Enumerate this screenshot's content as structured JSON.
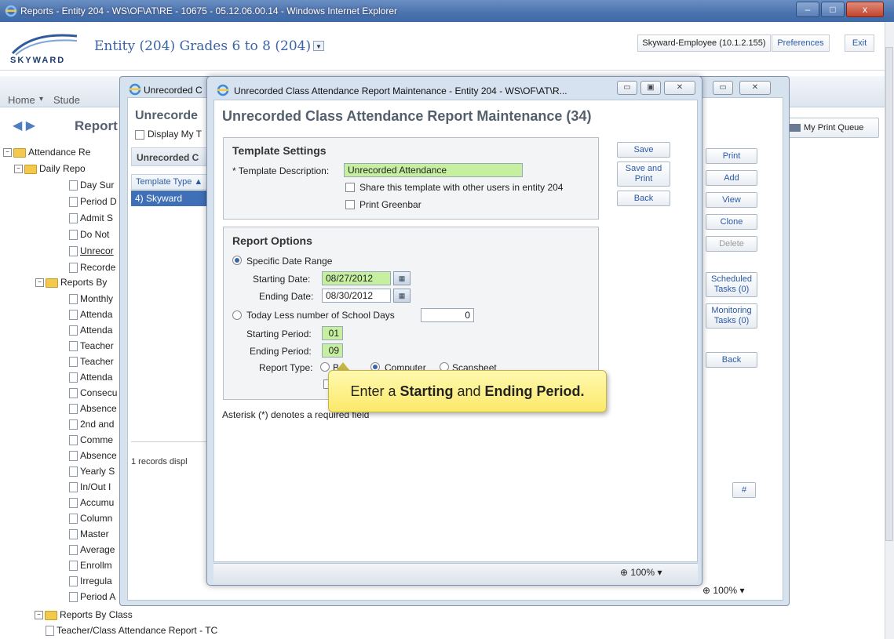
{
  "window": {
    "title": "Reports - Entity 204 - WS\\OF\\AT\\RE - 10675 - 05.12.06.00.14 - Windows Internet Explorer",
    "min": "–",
    "max": "□",
    "close": "x"
  },
  "header": {
    "logo": "SKYWARD",
    "entity_title": "Entity (204) Grades 6 to 8 (204)",
    "entity_dropdown": "▼",
    "user": "Skyward-Employee (10.1.2.155)",
    "preferences": "Preferences",
    "exit": "Exit"
  },
  "nav": {
    "home": "Home",
    "home_arrow": "▾",
    "student": "Stude"
  },
  "report_area": {
    "arrows": "◀ ▶",
    "title": "Report",
    "print_queue": "My Print Queue"
  },
  "tree": {
    "root": "Attendance Re",
    "daily": "Daily Repo",
    "daily_items": [
      "Day Sur",
      "Period D",
      "Admit S",
      "Do Not",
      "Unrecor",
      "Recorde"
    ],
    "reports_by": "Reports By",
    "reports_by_items": [
      "Monthly",
      "Attenda",
      "Attenda",
      "Teacher",
      "Teacher",
      "Attenda",
      "Consecu",
      "Absence",
      "2nd and",
      "Comme",
      "Absence",
      "Yearly S",
      "In/Out I",
      "Accumu",
      "Column",
      "Master",
      "Average",
      "Enrollm",
      "Irregula",
      "Period A"
    ],
    "by_class": "Reports By Class",
    "by_class_items": [
      "Teacher/Class Attendance Report - TC"
    ]
  },
  "back_window": {
    "title": "Unrecorded C",
    "heading": "Unrecorde",
    "display_my": "Display My T",
    "grid_heading": "Unrecorded C",
    "column": "Template Type ▲",
    "row": "4) Skyward",
    "records": "1 records displ",
    "zoom": "100%",
    "buttons": {
      "print": "Print",
      "add": "Add",
      "view": "View",
      "clone": "Clone",
      "delete": "Delete",
      "scheduled": "Scheduled Tasks (0)",
      "monitoring": "Monitoring Tasks (0)",
      "back": "Back",
      "hash": "#"
    }
  },
  "dialog": {
    "title": "Unrecorded Class Attendance Report Maintenance - Entity 204 - WS\\OF\\AT\\R...",
    "heading": "Unrecorded Class Attendance Report Maintenance (34)",
    "template_settings": {
      "title": "Template Settings",
      "desc_label": "* Template Description:",
      "desc_value": "Unrecorded Attendance",
      "share_label": "Share this template with other users in entity 204",
      "greenbar_label": "Print Greenbar"
    },
    "side_buttons": {
      "save": "Save",
      "save_print": "Save and Print",
      "back": "Back"
    },
    "report_options": {
      "title": "Report Options",
      "specific_range": "Specific Date Range",
      "starting_date_label": "Starting Date:",
      "starting_date": "08/27/2012",
      "ending_date_label": "Ending Date:",
      "ending_date": "08/30/2012",
      "today_less": "Today Less number of School Days",
      "today_less_value": "0",
      "starting_period_label": "Starting Period:",
      "starting_period": "01",
      "ending_period_label": "Ending Period:",
      "ending_period": "09",
      "report_type_label": "Report Type:",
      "type_both": "B",
      "type_computer": "Computer",
      "type_scansheet": "Scansheet"
    },
    "asterisk_note": "Asterisk (*) denotes a required field",
    "zoom": "100%",
    "zoom_arrow": "▾"
  },
  "tooltip": {
    "pre": "Enter a ",
    "bold1": "Starting",
    "mid": " and ",
    "bold2": "Ending Period."
  },
  "colors": {
    "required_field": "#c6f0a0",
    "tooltip": "#fbe96a",
    "accent": "#3a63a8"
  }
}
